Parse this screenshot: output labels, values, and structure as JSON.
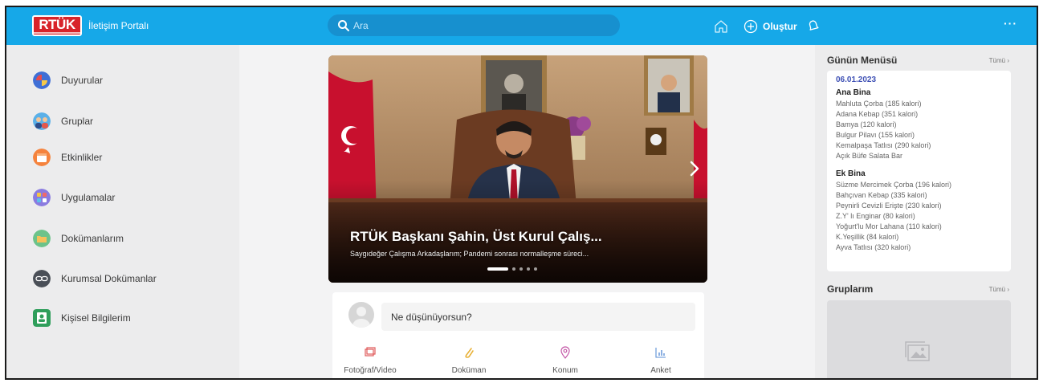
{
  "header": {
    "logo_text": "RTÜK",
    "portal_title": "İletişim Portalı",
    "search_placeholder": "Ara",
    "create_label": "Oluştur",
    "more_label": "···",
    "accent": "#16a8e8"
  },
  "sidebar": {
    "items": [
      {
        "label": "Duyurular",
        "icon": "announcement-icon"
      },
      {
        "label": "Gruplar",
        "icon": "groups-icon"
      },
      {
        "label": "Etkinlikler",
        "icon": "calendar-icon"
      },
      {
        "label": "Uygulamalar",
        "icon": "apps-icon"
      },
      {
        "label": "Dokümanlarım",
        "icon": "folder-icon"
      },
      {
        "label": "Kurumsal Dokümanlar",
        "icon": "link-icon"
      },
      {
        "label": "Kişisel Bilgilerim",
        "icon": "person-icon"
      }
    ]
  },
  "carousel": {
    "title": "RTÜK Başkanı Şahin, Üst Kurul Çalış...",
    "subtitle": "Saygıdeğer Çalışma Arkadaşlarım; Pandemi sonrası normalleşme süreci...",
    "slide_count": 5,
    "active_slide": 1
  },
  "composer": {
    "placeholder": "Ne düşünüyorsun?",
    "actions": [
      {
        "label": "Fotoğraf/Video",
        "icon": "photo-video-icon"
      },
      {
        "label": "Doküman",
        "icon": "paperclip-icon"
      },
      {
        "label": "Konum",
        "icon": "location-pin-icon"
      },
      {
        "label": "Anket",
        "icon": "poll-chart-icon"
      }
    ]
  },
  "daily_menu": {
    "title": "Günün Menüsü",
    "all_label": "Tümü ›",
    "date": "06.01.2023",
    "sections": [
      {
        "name": "Ana Bina",
        "items": [
          "Mahluta Çorba (185 kalori)",
          "Adana Kebap (351 kalori)",
          "Bamya (120 kalori)",
          "Bulgur Pilavı (155 kalori)",
          "Kemalpaşa Tatlısı (290 kalori)",
          "Açık Büfe Salata Bar"
        ]
      },
      {
        "name": "Ek Bina",
        "items": [
          "Süzme Mercimek Çorba (196 kalori)",
          "Bahçıvan Kebap (335 kalori)",
          "Peynirli Cevizli Erişte (230 kalori)",
          "Z.Y' lı Enginar (80 kalori)",
          "Yoğurt'lu Mor Lahana (110 kalori)",
          "K.Yeşillik (84 kalori)",
          "Ayva Tatlısı (320 kalori)"
        ]
      }
    ]
  },
  "my_groups": {
    "title": "Gruplarım",
    "all_label": "Tümü ›"
  }
}
